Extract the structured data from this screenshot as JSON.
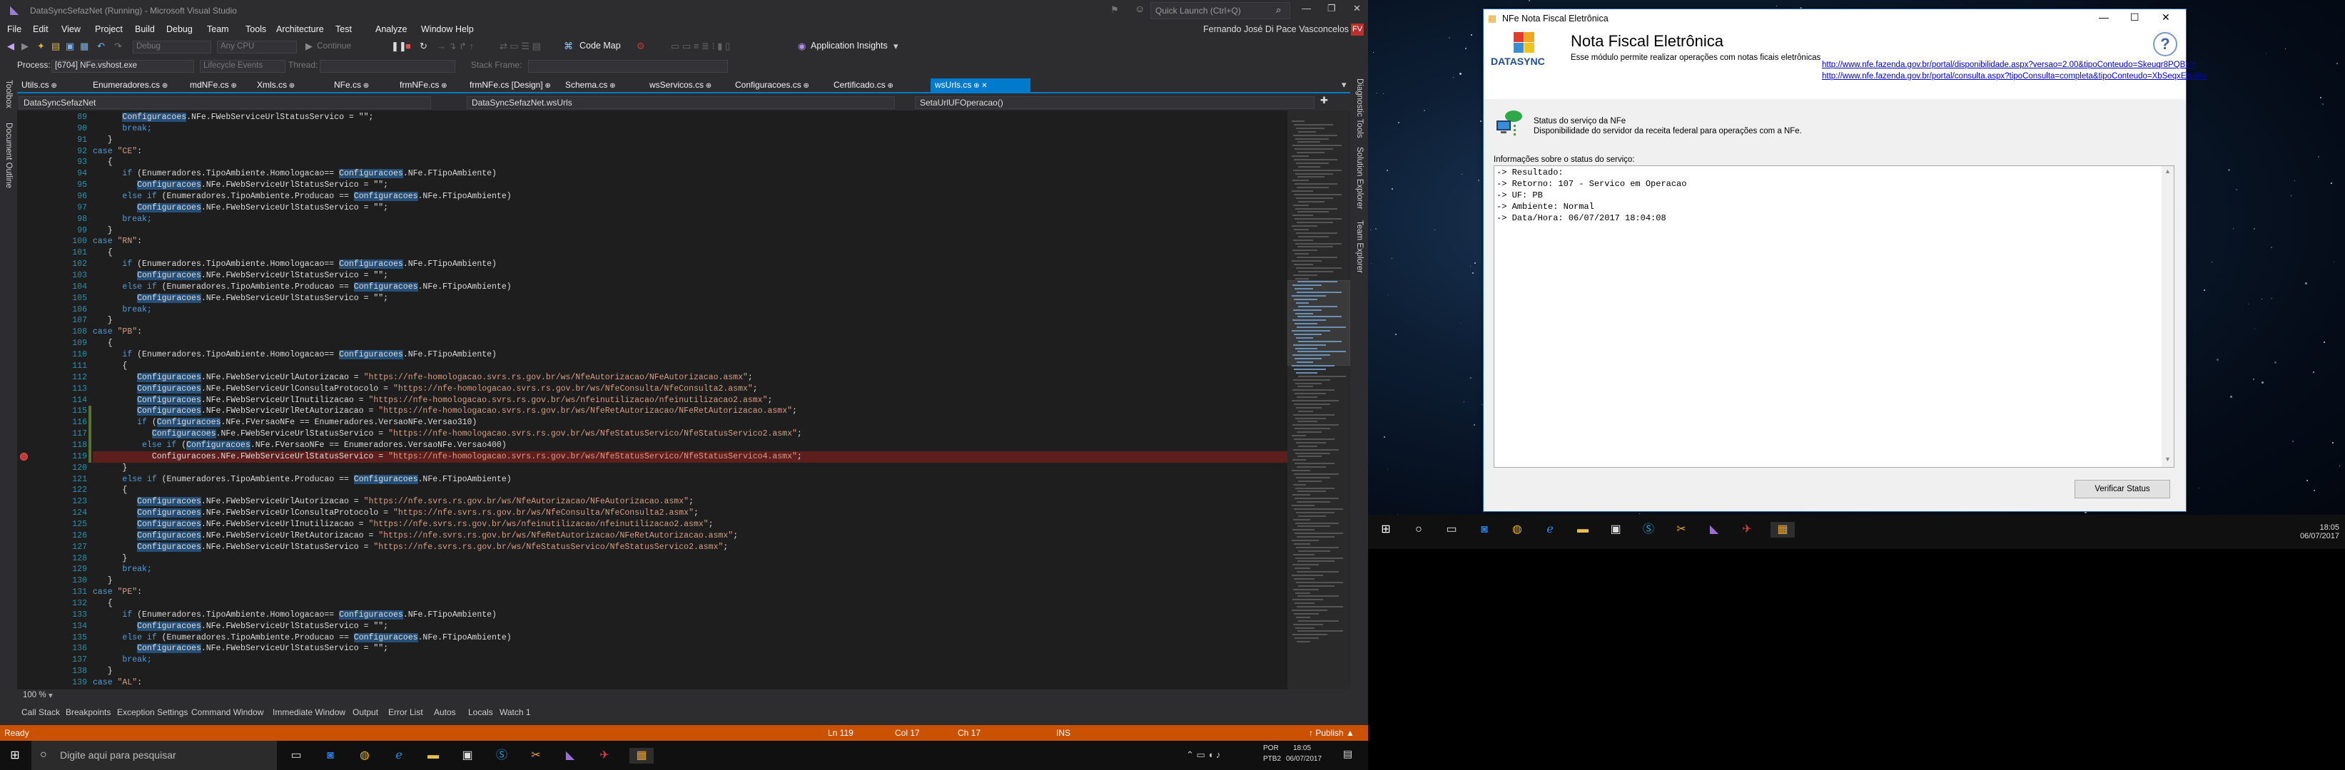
{
  "vs": {
    "title": "DataSyncSefazNet (Running) - Microsoft Visual Studio",
    "quick_launch": "Quick Launch (Ctrl+Q)",
    "user": "Fernando José Di Pace Vasconcelos",
    "user_initials": "FV",
    "menu": [
      "File",
      "Edit",
      "View",
      "Project",
      "Build",
      "Debug",
      "Team",
      "Tools",
      "Architecture",
      "Test",
      "Analyze",
      "Window",
      "Help"
    ],
    "toolbar": {
      "config": "Debug",
      "cpu": "Any CPU",
      "continue": "Continue",
      "codemap": "Code Map",
      "insights": "Application Insights"
    },
    "toolbar2": {
      "process_label": "Process:",
      "process": "[6704] NFe.vshost.exe",
      "lifecycle": "Lifecycle Events",
      "thread_label": "Thread:",
      "stackframe_label": "Stack Frame:"
    },
    "tabs": [
      "Utils.cs",
      "Enumeradores.cs",
      "mdNFe.cs",
      "Xmls.cs",
      "NFe.cs",
      "frmNFe.cs",
      "frmNFe.cs [Design]",
      "Schema.cs",
      "wsServicos.cs",
      "Configuracoes.cs",
      "Certificado.cs",
      "wsUrls.cs"
    ],
    "nav": {
      "project": "DataSyncSefazNet",
      "class": "DataSyncSefazNet.wsUrls",
      "member": "SetaUrlUFOperacao()"
    },
    "left_dock": [
      "Toolbox",
      "Document Outline"
    ],
    "right_dock": [
      "Diagnostic Tools",
      "Solution Explorer",
      "Team Explorer"
    ],
    "zoom": "100 %",
    "bottom_tabs": [
      "Call Stack",
      "Breakpoints",
      "Exception Settings",
      "Command Window",
      "Immediate Window",
      "Output",
      "Error List",
      "Autos",
      "Locals",
      "Watch 1"
    ],
    "status": {
      "ready": "Ready",
      "ln": "Ln 119",
      "col": "Col 17",
      "ch": "Ch 17",
      "ins": "INS",
      "publish": "↑ Publish ▲"
    },
    "accent": "#007acc",
    "status_color": "#ca5100"
  },
  "code": {
    "first_line_number": 89,
    "breakpoint_line": 119,
    "lines": [
      [
        [
          "      ",
          ""
        ],
        [
          "Configuracoes",
          "hl"
        ],
        [
          ".NFe.FWebServiceUrlStatusServico = ",
          ""
        ],
        [
          "\"\"",
          ""
        ],
        [
          ";",
          ""
        ]
      ],
      [
        [
          "      break;",
          "kw"
        ]
      ],
      [
        [
          "   }",
          ""
        ]
      ],
      [
        [
          "case ",
          "kw"
        ],
        [
          "\"CE\"",
          "str"
        ],
        [
          ":",
          ""
        ]
      ],
      [
        [
          "   {",
          ""
        ]
      ],
      [
        [
          "      ",
          "kw"
        ],
        [
          "if ",
          "kw"
        ],
        [
          "(Enumeradores.TipoAmbiente.Homologacao== ",
          ""
        ],
        [
          "Configuracoes",
          "hl"
        ],
        [
          ".NFe.FTipoAmbiente)",
          ""
        ]
      ],
      [
        [
          "         ",
          ""
        ],
        [
          "Configuracoes",
          "hl"
        ],
        [
          ".NFe.FWebServiceUrlStatusServico = \"\";",
          ""
        ]
      ],
      [
        [
          "      ",
          ""
        ],
        [
          "else if ",
          "kw"
        ],
        [
          "(Enumeradores.TipoAmbiente.Producao == ",
          ""
        ],
        [
          "Configuracoes",
          "hl"
        ],
        [
          ".NFe.FTipoAmbiente)",
          ""
        ]
      ],
      [
        [
          "         ",
          ""
        ],
        [
          "Configuracoes",
          "hl"
        ],
        [
          ".NFe.FWebServiceUrlStatusServico = \"\";",
          ""
        ]
      ],
      [
        [
          "      break;",
          "kw"
        ]
      ],
      [
        [
          "   }",
          ""
        ]
      ],
      [
        [
          "case ",
          "kw"
        ],
        [
          "\"RN\"",
          "str"
        ],
        [
          ":",
          ""
        ]
      ],
      [
        [
          "   {",
          ""
        ]
      ],
      [
        [
          "      ",
          ""
        ],
        [
          "if ",
          "kw"
        ],
        [
          "(Enumeradores.TipoAmbiente.Homologacao== ",
          ""
        ],
        [
          "Configuracoes",
          "hl"
        ],
        [
          ".NFe.FTipoAmbiente)",
          ""
        ]
      ],
      [
        [
          "         ",
          ""
        ],
        [
          "Configuracoes",
          "hl"
        ],
        [
          ".NFe.FWebServiceUrlStatusServico = \"\";",
          ""
        ]
      ],
      [
        [
          "      ",
          ""
        ],
        [
          "else if ",
          "kw"
        ],
        [
          "(Enumeradores.TipoAmbiente.Producao == ",
          ""
        ],
        [
          "Configuracoes",
          "hl"
        ],
        [
          ".NFe.FTipoAmbiente)",
          ""
        ]
      ],
      [
        [
          "         ",
          ""
        ],
        [
          "Configuracoes",
          "hl"
        ],
        [
          ".NFe.FWebServiceUrlStatusServico = \"\";",
          ""
        ]
      ],
      [
        [
          "      break;",
          "kw"
        ]
      ],
      [
        [
          "   }",
          ""
        ]
      ],
      [
        [
          "case ",
          "kw"
        ],
        [
          "\"PB\"",
          "str"
        ],
        [
          ":",
          ""
        ]
      ],
      [
        [
          "   {",
          ""
        ]
      ],
      [
        [
          "      ",
          ""
        ],
        [
          "if ",
          "kw"
        ],
        [
          "(Enumeradores.TipoAmbiente.Homologacao== ",
          ""
        ],
        [
          "Configuracoes",
          "hl"
        ],
        [
          ".NFe.FTipoAmbiente)",
          ""
        ]
      ],
      [
        [
          "      {",
          ""
        ]
      ],
      [
        [
          "         ",
          ""
        ],
        [
          "Configuracoes",
          "hl"
        ],
        [
          ".NFe.FWebServiceUrlAutorizacao = ",
          ""
        ],
        [
          "\"https://nfe-homologacao.svrs.rs.gov.br/ws/NfeAutorizacao/NFeAutorizacao.asmx\"",
          "str"
        ],
        [
          ";",
          ""
        ]
      ],
      [
        [
          "         ",
          ""
        ],
        [
          "Configuracoes",
          "hl"
        ],
        [
          ".NFe.FWebServiceUrlConsultaProtocolo = ",
          ""
        ],
        [
          "\"https://nfe-homologacao.svrs.rs.gov.br/ws/NfeConsulta/NfeConsulta2.asmx\"",
          "str"
        ],
        [
          ";",
          ""
        ]
      ],
      [
        [
          "         ",
          ""
        ],
        [
          "Configuracoes",
          "hl"
        ],
        [
          ".NFe.FWebServiceUrlInutilizacao = ",
          ""
        ],
        [
          "\"https://nfe-homologacao.svrs.rs.gov.br/ws/nfeinutilizacao/nfeinutilizacao2.asmx\"",
          "str"
        ],
        [
          ";",
          ""
        ]
      ],
      [
        [
          "         ",
          ""
        ],
        [
          "Configuracoes",
          "hl"
        ],
        [
          ".NFe.FWebServiceUrlRetAutorizacao = ",
          ""
        ],
        [
          "\"https://nfe-homologacao.svrs.rs.gov.br/ws/NfeRetAutorizacao/NFeRetAutorizacao.asmx\"",
          "str"
        ],
        [
          ";",
          ""
        ]
      ],
      [
        [
          "         ",
          ""
        ],
        [
          "if ",
          "kw"
        ],
        [
          "(",
          ""
        ],
        [
          "Configuracoes",
          "hl"
        ],
        [
          ".NFe.FVersaoNFe == Enumeradores.VersaoNFe.Versao310)",
          ""
        ]
      ],
      [
        [
          "            ",
          ""
        ],
        [
          "Configuracoes",
          "hl"
        ],
        [
          ".NFe.FWebServiceUrlStatusServico = ",
          ""
        ],
        [
          "\"https://nfe-homologacao.svrs.rs.gov.br/ws/NfeStatusServico/NfeStatusServico2.asmx\"",
          "str"
        ],
        [
          ";",
          ""
        ]
      ],
      [
        [
          "          ",
          ""
        ],
        [
          "else if ",
          "kw"
        ],
        [
          "(",
          ""
        ],
        [
          "Configuracoes",
          "hl"
        ],
        [
          ".NFe.FVersaoNFe == Enumeradores.VersaoNFe.Versao400)",
          ""
        ]
      ],
      [
        [
          "            Configuracoes.NFe.FWebServiceUrlStatusServico = ",
          ""
        ],
        [
          "\"https://nfe-homologacao.svrs.rs.gov.br/ws/NfeStatusServico/NfeStatusServico4.asmx\"",
          "str"
        ],
        [
          ";",
          ""
        ]
      ],
      [
        [
          "      }",
          ""
        ]
      ],
      [
        [
          "      ",
          ""
        ],
        [
          "else if ",
          "kw"
        ],
        [
          "(Enumeradores.TipoAmbiente.Producao == ",
          ""
        ],
        [
          "Configuracoes",
          "hl"
        ],
        [
          ".NFe.FTipoAmbiente)",
          ""
        ]
      ],
      [
        [
          "      {",
          ""
        ]
      ],
      [
        [
          "         ",
          ""
        ],
        [
          "Configuracoes",
          "hl"
        ],
        [
          ".NFe.FWebServiceUrlAutorizacao = ",
          ""
        ],
        [
          "\"https://nfe.svrs.rs.gov.br/ws/NfeAutorizacao/NFeAutorizacao.asmx\"",
          "str"
        ],
        [
          ";",
          ""
        ]
      ],
      [
        [
          "         ",
          ""
        ],
        [
          "Configuracoes",
          "hl"
        ],
        [
          ".NFe.FWebServiceUrlConsultaProtocolo = ",
          ""
        ],
        [
          "\"https://nfe.svrs.rs.gov.br/ws/NfeConsulta/NfeConsulta2.asmx\"",
          "str"
        ],
        [
          ";",
          ""
        ]
      ],
      [
        [
          "         ",
          ""
        ],
        [
          "Configuracoes",
          "hl"
        ],
        [
          ".NFe.FWebServiceUrlInutilizacao = ",
          ""
        ],
        [
          "\"https://nfe.svrs.rs.gov.br/ws/nfeinutilizacao/nfeinutilizacao2.asmx\"",
          "str"
        ],
        [
          ";",
          ""
        ]
      ],
      [
        [
          "         ",
          ""
        ],
        [
          "Configuracoes",
          "hl"
        ],
        [
          ".NFe.FWebServiceUrlRetAutorizacao = ",
          ""
        ],
        [
          "\"https://nfe.svrs.rs.gov.br/ws/NfeRetAutorizacao/NFeRetAutorizacao.asmx\"",
          "str"
        ],
        [
          ";",
          ""
        ]
      ],
      [
        [
          "         ",
          ""
        ],
        [
          "Configuracoes",
          "hl"
        ],
        [
          ".NFe.FWebServiceUrlStatusServico = ",
          ""
        ],
        [
          "\"https://nfe.svrs.rs.gov.br/ws/NfeStatusServico/NfeStatusServico2.asmx\"",
          "str"
        ],
        [
          ";",
          ""
        ]
      ],
      [
        [
          "      }",
          ""
        ]
      ],
      [
        [
          "      break;",
          "kw"
        ]
      ],
      [
        [
          "   }",
          ""
        ]
      ],
      [
        [
          "case ",
          "kw"
        ],
        [
          "\"PE\"",
          "str"
        ],
        [
          ":",
          ""
        ]
      ],
      [
        [
          "   {",
          ""
        ]
      ],
      [
        [
          "      ",
          ""
        ],
        [
          "if ",
          "kw"
        ],
        [
          "(Enumeradores.TipoAmbiente.Homologacao== ",
          ""
        ],
        [
          "Configuracoes",
          "hl"
        ],
        [
          ".NFe.FTipoAmbiente)",
          ""
        ]
      ],
      [
        [
          "         ",
          ""
        ],
        [
          "Configuracoes",
          "hl"
        ],
        [
          ".NFe.FWebServiceUrlStatusServico = \"\";",
          ""
        ]
      ],
      [
        [
          "      ",
          ""
        ],
        [
          "else if ",
          "kw"
        ],
        [
          "(Enumeradores.TipoAmbiente.Producao == ",
          ""
        ],
        [
          "Configuracoes",
          "hl"
        ],
        [
          ".NFe.FTipoAmbiente)",
          ""
        ]
      ],
      [
        [
          "         ",
          ""
        ],
        [
          "Configuracoes",
          "hl"
        ],
        [
          ".NFe.FWebServiceUrlStatusServico = \"\";",
          ""
        ]
      ],
      [
        [
          "      break;",
          "kw"
        ]
      ],
      [
        [
          "   }",
          ""
        ]
      ],
      [
        [
          "case ",
          "kw"
        ],
        [
          "\"AL\"",
          "str"
        ],
        [
          ":",
          ""
        ]
      ]
    ]
  },
  "nfe": {
    "window_title": "NFe Nota Fiscal Eletrônica",
    "logo_text": "DATASYNC",
    "heading": "Nota Fiscal Eletrônica",
    "subheading": "Esse módulo permite realizar operações com notas ficais eletrônicas",
    "link1": "http://www.nfe.fazenda.gov.br/portal/disponibilidade.aspx?versao=2.00&tipoConteudo=Skeuqr8PQBY=",
    "link2": "http://www.nfe.fazenda.gov.br/portal/consulta.aspx?tipoConsulta=completa&tipoConteudo=XbSeqxE8pl8=",
    "status_title": "Status do serviço da NFe",
    "status_sub": "Disponibilidade do servidor da receita federal para operações com a NFe.",
    "info_label": "Informações sobre o status do serviço:",
    "result": "-> Resultado:\n-> Retorno: 107 - Servico em Operacao\n-> UF: PB\n-> Ambiente: Normal\n-> Data/Hora: 06/07/2017 18:04:08",
    "verify_button": "Verificar Status"
  },
  "taskbar": {
    "search_placeholder": "Digite aqui para pesquisar",
    "lang": "POR",
    "kbd": "PTB2",
    "time": "18:05",
    "date": "06/07/2017"
  }
}
